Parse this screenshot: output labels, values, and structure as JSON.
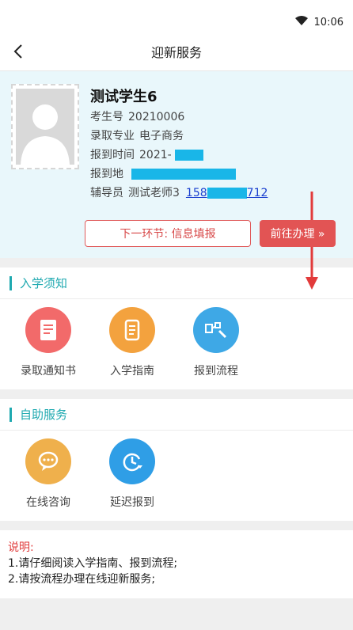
{
  "status": {
    "time": "10:06",
    "wifi_icon": "wifi-icon"
  },
  "nav": {
    "title": "迎新服务",
    "back_icon": "back-icon"
  },
  "profile": {
    "name": "测试学生6",
    "exam_no_label": "考生号",
    "exam_no_value": "20210006",
    "major_label": "录取专业",
    "major_value": "电子商务",
    "report_time_label": "报到时间",
    "report_time_value": "2021-",
    "report_place_label": "报到地",
    "counselor_label": "辅导员",
    "counselor_value": "测试老师3",
    "phone_prefix": "158",
    "phone_suffix": "712"
  },
  "buttons": {
    "next_step": "下一环节: 信息填报",
    "go_handle": "前往办理 »"
  },
  "sections": {
    "enrollment": {
      "title": "入学须知",
      "items": [
        {
          "label": "录取通知书",
          "icon": "admission-letter-icon",
          "color": "#f26a6a"
        },
        {
          "label": "入学指南",
          "icon": "scroll-guide-icon",
          "color": "#f3a23e"
        },
        {
          "label": "报到流程",
          "icon": "flow-icon",
          "color": "#3ea8e6"
        }
      ]
    },
    "self_service": {
      "title": "自助服务",
      "items": [
        {
          "label": "在线咨询",
          "icon": "chat-icon",
          "color": "#efb04c"
        },
        {
          "label": "延迟报到",
          "icon": "clock-icon",
          "color": "#2f9ee6"
        }
      ]
    }
  },
  "notes": {
    "title": "说明:",
    "line1": "1.请仔细阅读入学指南、报到流程;",
    "line2": "2.请按流程办理在线迎新服务;"
  }
}
